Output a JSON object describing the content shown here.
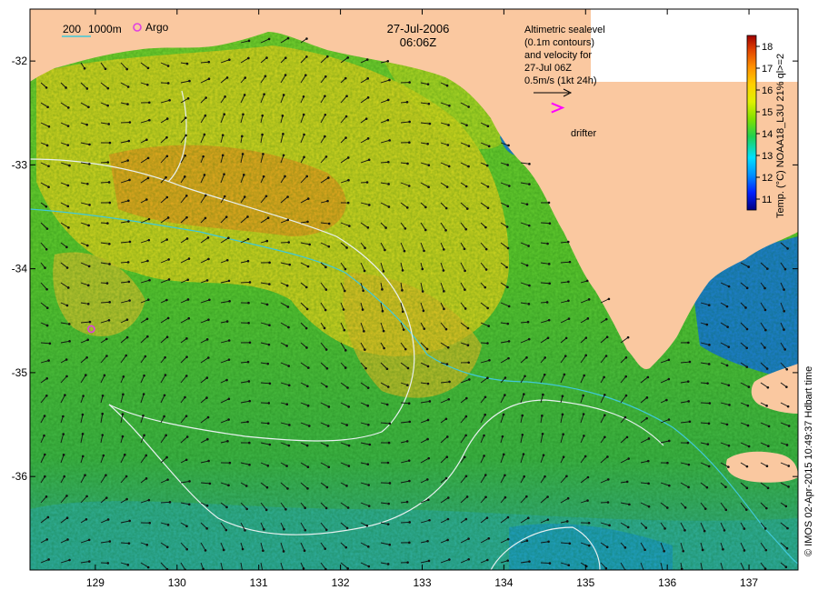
{
  "map": {
    "date_line1": "27-Jul-2006",
    "date_line2": "06:06Z",
    "depth_legend": {
      "shallow": "200",
      "deep": "1000m",
      "shallow_color": "#40c8d8",
      "deep_color": "#e8f0f0"
    },
    "argo_label": "Argo",
    "drifter_label": "drifter",
    "altimetry_lines": [
      "Altimetric sealevel",
      "(0.1m contours)",
      "and velocity for",
      "27-Jul 06Z",
      "0.5m/s (1kt 24h)"
    ],
    "credit": "© IMOS 02-Apr-2015 10:49:37 Hdbart time",
    "x_ticks": [
      "129",
      "130",
      "131",
      "132",
      "133",
      "134",
      "135",
      "136",
      "137"
    ],
    "y_ticks": [
      "-32",
      "-33",
      "-34",
      "-35",
      "-36"
    ],
    "lon_range": [
      128.2,
      137.6
    ],
    "lat_range": [
      -36.9,
      -31.5
    ],
    "land_color": "#fac8a0",
    "argo_position": {
      "lon": 128.95,
      "lat": -34.58
    },
    "drifter_position": {
      "lon": 134.65,
      "lat": -32.45
    }
  },
  "colorbar": {
    "label": "Temp. (°C) NOAA18_L3U 21% ql>=2",
    "ticks": [
      "11",
      "12",
      "13",
      "14",
      "15",
      "16",
      "17",
      "18"
    ],
    "range": [
      10.5,
      18.5
    ],
    "colors": [
      "#000080",
      "#0020ff",
      "#0090ff",
      "#00e0ff",
      "#20d050",
      "#80e000",
      "#e0f000",
      "#ffd000",
      "#ff9000",
      "#e04000",
      "#a00000"
    ]
  }
}
